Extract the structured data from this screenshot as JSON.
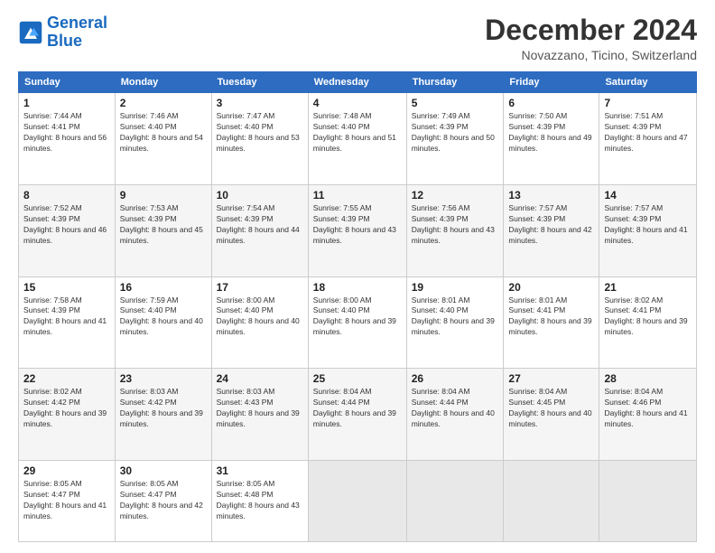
{
  "logo": {
    "line1": "General",
    "line2": "Blue"
  },
  "title": "December 2024",
  "subtitle": "Novazzano, Ticino, Switzerland",
  "weekdays": [
    "Sunday",
    "Monday",
    "Tuesday",
    "Wednesday",
    "Thursday",
    "Friday",
    "Saturday"
  ],
  "weeks": [
    [
      {
        "day": "1",
        "sunrise": "7:44 AM",
        "sunset": "4:41 PM",
        "daylight": "8 hours and 56 minutes."
      },
      {
        "day": "2",
        "sunrise": "7:46 AM",
        "sunset": "4:40 PM",
        "daylight": "8 hours and 54 minutes."
      },
      {
        "day": "3",
        "sunrise": "7:47 AM",
        "sunset": "4:40 PM",
        "daylight": "8 hours and 53 minutes."
      },
      {
        "day": "4",
        "sunrise": "7:48 AM",
        "sunset": "4:40 PM",
        "daylight": "8 hours and 51 minutes."
      },
      {
        "day": "5",
        "sunrise": "7:49 AM",
        "sunset": "4:39 PM",
        "daylight": "8 hours and 50 minutes."
      },
      {
        "day": "6",
        "sunrise": "7:50 AM",
        "sunset": "4:39 PM",
        "daylight": "8 hours and 49 minutes."
      },
      {
        "day": "7",
        "sunrise": "7:51 AM",
        "sunset": "4:39 PM",
        "daylight": "8 hours and 47 minutes."
      }
    ],
    [
      {
        "day": "8",
        "sunrise": "7:52 AM",
        "sunset": "4:39 PM",
        "daylight": "8 hours and 46 minutes."
      },
      {
        "day": "9",
        "sunrise": "7:53 AM",
        "sunset": "4:39 PM",
        "daylight": "8 hours and 45 minutes."
      },
      {
        "day": "10",
        "sunrise": "7:54 AM",
        "sunset": "4:39 PM",
        "daylight": "8 hours and 44 minutes."
      },
      {
        "day": "11",
        "sunrise": "7:55 AM",
        "sunset": "4:39 PM",
        "daylight": "8 hours and 43 minutes."
      },
      {
        "day": "12",
        "sunrise": "7:56 AM",
        "sunset": "4:39 PM",
        "daylight": "8 hours and 43 minutes."
      },
      {
        "day": "13",
        "sunrise": "7:57 AM",
        "sunset": "4:39 PM",
        "daylight": "8 hours and 42 minutes."
      },
      {
        "day": "14",
        "sunrise": "7:57 AM",
        "sunset": "4:39 PM",
        "daylight": "8 hours and 41 minutes."
      }
    ],
    [
      {
        "day": "15",
        "sunrise": "7:58 AM",
        "sunset": "4:39 PM",
        "daylight": "8 hours and 41 minutes."
      },
      {
        "day": "16",
        "sunrise": "7:59 AM",
        "sunset": "4:40 PM",
        "daylight": "8 hours and 40 minutes."
      },
      {
        "day": "17",
        "sunrise": "8:00 AM",
        "sunset": "4:40 PM",
        "daylight": "8 hours and 40 minutes."
      },
      {
        "day": "18",
        "sunrise": "8:00 AM",
        "sunset": "4:40 PM",
        "daylight": "8 hours and 39 minutes."
      },
      {
        "day": "19",
        "sunrise": "8:01 AM",
        "sunset": "4:40 PM",
        "daylight": "8 hours and 39 minutes."
      },
      {
        "day": "20",
        "sunrise": "8:01 AM",
        "sunset": "4:41 PM",
        "daylight": "8 hours and 39 minutes."
      },
      {
        "day": "21",
        "sunrise": "8:02 AM",
        "sunset": "4:41 PM",
        "daylight": "8 hours and 39 minutes."
      }
    ],
    [
      {
        "day": "22",
        "sunrise": "8:02 AM",
        "sunset": "4:42 PM",
        "daylight": "8 hours and 39 minutes."
      },
      {
        "day": "23",
        "sunrise": "8:03 AM",
        "sunset": "4:42 PM",
        "daylight": "8 hours and 39 minutes."
      },
      {
        "day": "24",
        "sunrise": "8:03 AM",
        "sunset": "4:43 PM",
        "daylight": "8 hours and 39 minutes."
      },
      {
        "day": "25",
        "sunrise": "8:04 AM",
        "sunset": "4:44 PM",
        "daylight": "8 hours and 39 minutes."
      },
      {
        "day": "26",
        "sunrise": "8:04 AM",
        "sunset": "4:44 PM",
        "daylight": "8 hours and 40 minutes."
      },
      {
        "day": "27",
        "sunrise": "8:04 AM",
        "sunset": "4:45 PM",
        "daylight": "8 hours and 40 minutes."
      },
      {
        "day": "28",
        "sunrise": "8:04 AM",
        "sunset": "4:46 PM",
        "daylight": "8 hours and 41 minutes."
      }
    ],
    [
      {
        "day": "29",
        "sunrise": "8:05 AM",
        "sunset": "4:47 PM",
        "daylight": "8 hours and 41 minutes."
      },
      {
        "day": "30",
        "sunrise": "8:05 AM",
        "sunset": "4:47 PM",
        "daylight": "8 hours and 42 minutes."
      },
      {
        "day": "31",
        "sunrise": "8:05 AM",
        "sunset": "4:48 PM",
        "daylight": "8 hours and 43 minutes."
      },
      null,
      null,
      null,
      null
    ]
  ]
}
